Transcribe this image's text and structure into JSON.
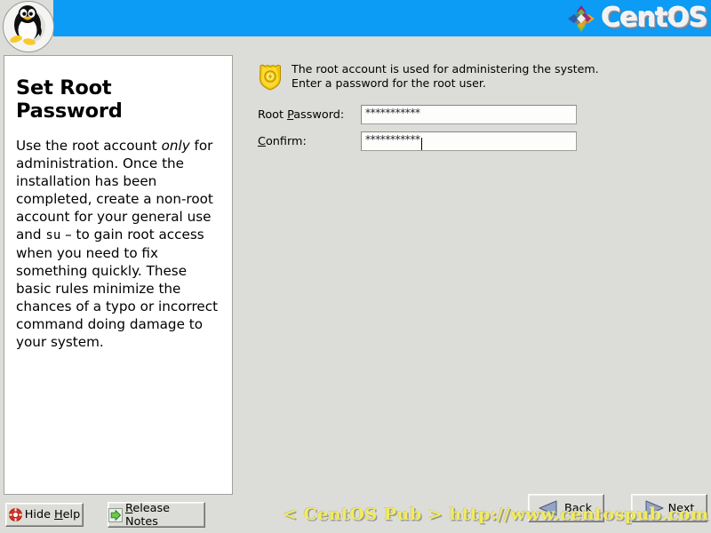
{
  "header": {
    "tux_icon": "tux-penguin-icon",
    "brand_mark_icon": "centos-diamond-icon",
    "brand_name": "CentOS",
    "banner_color": "#0c9bf5"
  },
  "help_panel": {
    "title": "Set Root Password",
    "body_part1": "Use the root account ",
    "body_emphasis": "only",
    "body_part2": " for administration. Once the installation has been completed, create a non-root account for your general use and ",
    "body_mono": "su",
    "body_part3": " – to gain root access when you need to fix something quickly. These basic rules minimize the chances of a typo or incorrect command doing damage to your system."
  },
  "main": {
    "info_icon": "gold-shield-badge-icon",
    "info_line1": "The root account is used for administering the system.",
    "info_line2": "Enter a password for the root user.",
    "fields": [
      {
        "label_pre": "Root ",
        "label_mnemonic": "P",
        "label_post": "assword:",
        "name": "root-password-input",
        "value": "***********",
        "focused": false
      },
      {
        "label_pre": "",
        "label_mnemonic": "C",
        "label_post": "onfirm:",
        "name": "confirm-password-input",
        "value": "***********",
        "focused": true
      }
    ]
  },
  "bottom": {
    "hide_help": {
      "icon": "lifebuoy-icon",
      "label_pre": "Hide ",
      "label_mnemonic": "H",
      "label_post": "elp"
    },
    "release_notes": {
      "icon": "green-arrow-icon",
      "label_pre": "",
      "label_mnemonic": "R",
      "label_post": "elease Notes"
    },
    "back": {
      "icon": "triangle-left-icon",
      "label": "Back"
    },
    "next": {
      "icon": "triangle-right-icon",
      "label": "Next"
    },
    "watermark": "< CentOS Pub > http://www.centospub.com"
  }
}
